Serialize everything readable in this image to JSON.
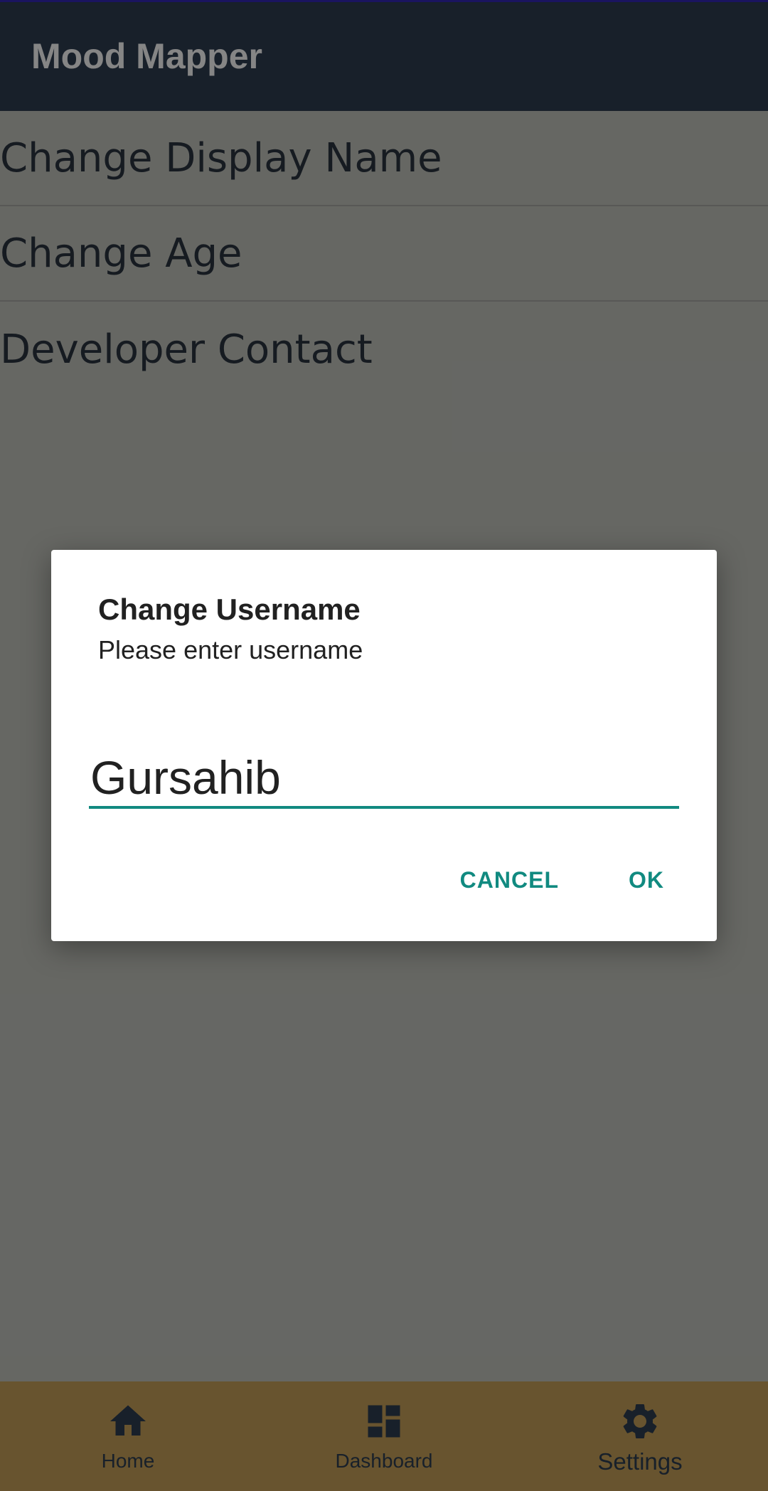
{
  "app": {
    "title": "Mood Mapper"
  },
  "settings": {
    "items": [
      {
        "label": "Change Display Name"
      },
      {
        "label": "Change Age"
      },
      {
        "label": "Developer Contact"
      }
    ]
  },
  "dialog": {
    "title": "Change Username",
    "message": "Please enter username",
    "input_value": "Gursahib",
    "cancel_label": "CANCEL",
    "ok_label": "OK"
  },
  "bottom_nav": {
    "items": [
      {
        "label": "Home",
        "icon": "home-icon"
      },
      {
        "label": "Dashboard",
        "icon": "dashboard-icon"
      },
      {
        "label": "Settings",
        "icon": "gear-icon",
        "active": true
      }
    ]
  },
  "colors": {
    "app_bar": "#2f3f52",
    "accent": "#118a80",
    "bottom_nav": "#c7a25a"
  }
}
